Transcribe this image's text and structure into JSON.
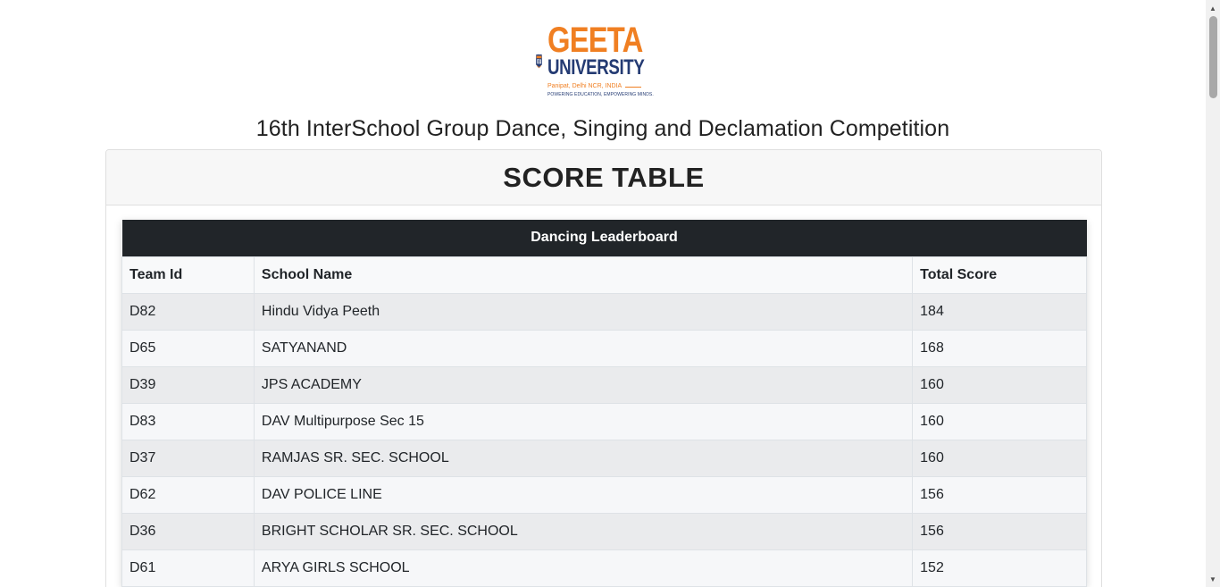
{
  "logo": {
    "emblem_text": "GEETA UNIVERSITY",
    "emblem_initials": "GU",
    "name_line1": "GEETA",
    "name_line2": "UNIVERSITY",
    "location": "Panipat, Delhi NCR, INDIA",
    "tagline": "POWERING EDUCATION, EMPOWERING MINDS.",
    "colors": {
      "orange": "#f07f22",
      "navy": "#243b73"
    }
  },
  "event_title": "16th InterSchool Group Dance, Singing and Declamation Competition",
  "card": {
    "header": "SCORE TABLE"
  },
  "leaderboard": {
    "caption": "Dancing Leaderboard",
    "columns": [
      "Team Id",
      "School Name",
      "Total Score"
    ],
    "rows": [
      [
        "D82",
        "Hindu Vidya Peeth",
        "184"
      ],
      [
        "D65",
        "SATYANAND",
        "168"
      ],
      [
        "D39",
        "JPS ACADEMY",
        "160"
      ],
      [
        "D83",
        "DAV Multipurpose Sec 15",
        "160"
      ],
      [
        "D37",
        "RAMJAS SR. SEC. SCHOOL",
        "160"
      ],
      [
        "D62",
        "DAV POLICE LINE",
        "156"
      ],
      [
        "D36",
        "BRIGHT SCHOLAR SR. SEC. SCHOOL",
        "156"
      ],
      [
        "D61",
        "ARYA GIRLS SCHOOL",
        "152"
      ]
    ]
  },
  "scrollbar": {
    "up_icon": "triangle-up-icon",
    "down_icon": "triangle-down-icon"
  }
}
